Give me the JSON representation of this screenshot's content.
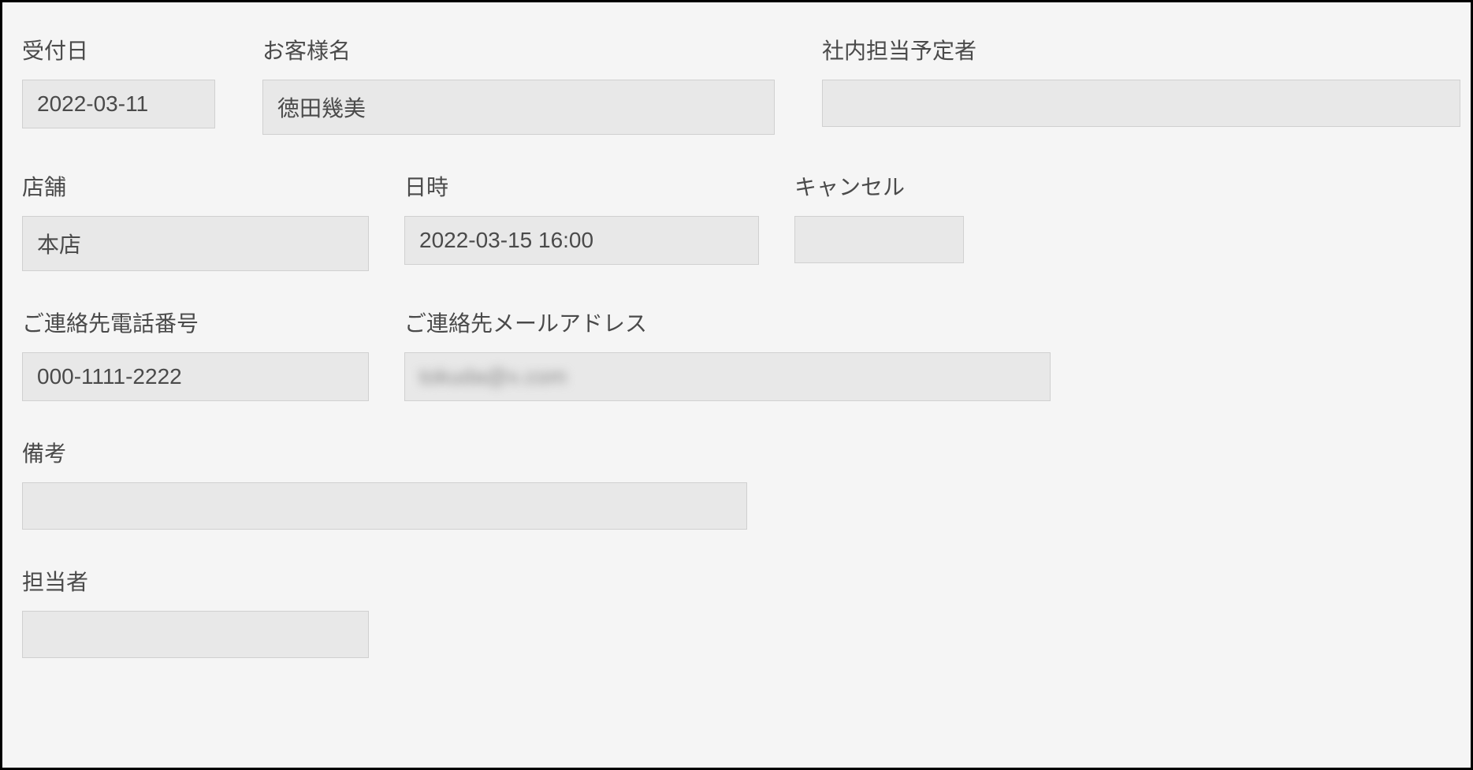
{
  "form": {
    "reception_date": {
      "label": "受付日",
      "value": "2022-03-11"
    },
    "customer_name": {
      "label": "お客様名",
      "value": "徳田幾美"
    },
    "internal_person": {
      "label": "社内担当予定者",
      "value": ""
    },
    "store": {
      "label": "店舗",
      "value": "本店"
    },
    "datetime": {
      "label": "日時",
      "value": "2022-03-15 16:00"
    },
    "cancel": {
      "label": "キャンセル",
      "value": ""
    },
    "phone": {
      "label": "ご連絡先電話番号",
      "value": "000-1111-2222"
    },
    "email": {
      "label": "ご連絡先メールアドレス",
      "value": "tokuda@x.com"
    },
    "notes": {
      "label": "備考",
      "value": ""
    },
    "person_in_charge": {
      "label": "担当者",
      "value": ""
    }
  }
}
